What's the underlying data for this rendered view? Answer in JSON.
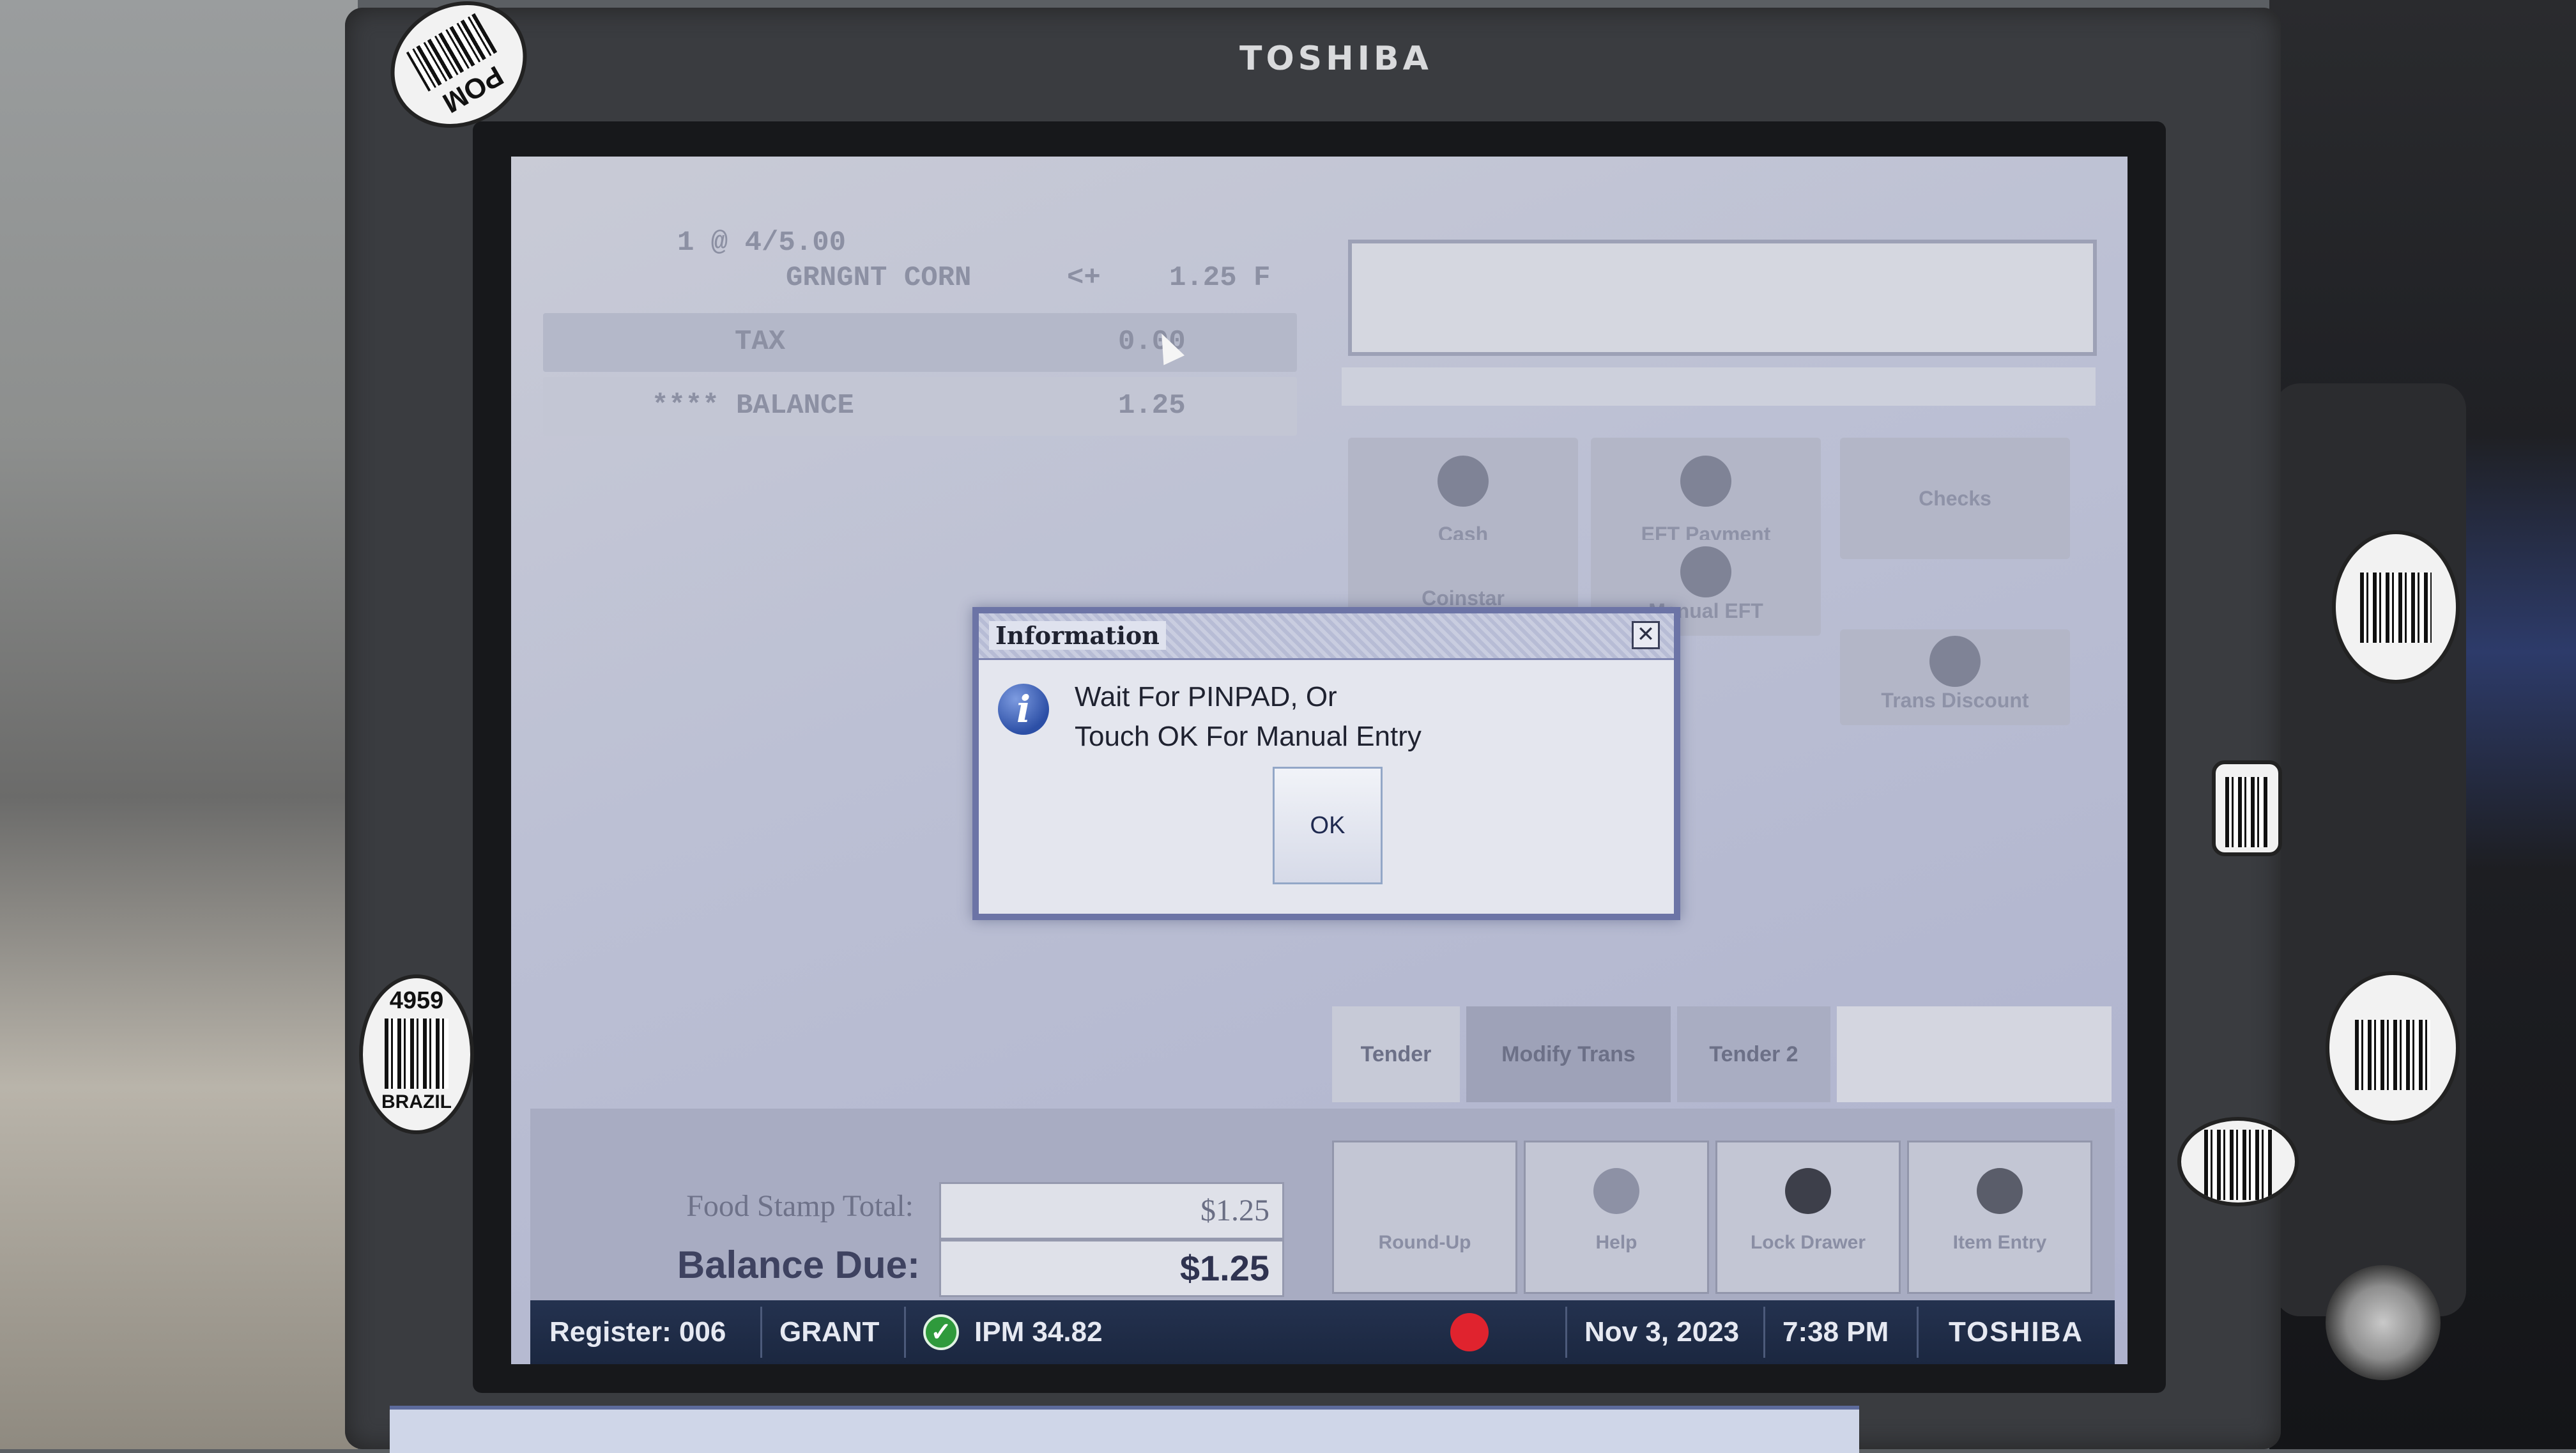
{
  "monitor": {
    "brand_top": "TOSHIBA"
  },
  "receipt": {
    "qty_line": "1 @ 4/5.00",
    "item_name": "GRNGNT CORN",
    "item_mark": "<+",
    "item_price": "1.25 F",
    "tax_label": "TAX",
    "tax_value": "0.00",
    "balance_label": "**** BALANCE",
    "balance_value": "1.25"
  },
  "tender_buttons": {
    "cash": "Cash",
    "eft": "EFT Payment",
    "checks": "Checks",
    "coinstar": "Coinstar",
    "manual_eft": "Manual EFT",
    "trans_discount": "Trans Discount"
  },
  "tabs": [
    "Tender",
    "Modify Trans",
    "Tender 2"
  ],
  "totals": {
    "food_stamp_label": "Food Stamp Total:",
    "food_stamp_value": "$1.25",
    "balance_due_label": "Balance Due:",
    "balance_due_value": "$1.25"
  },
  "function_buttons": [
    "Round-Up",
    "Help",
    "Lock Drawer",
    "Item Entry"
  ],
  "status_bar": {
    "register": "Register: 006",
    "cashier": "GRANT",
    "ipm": "IPM 34.82",
    "date": "Nov 3, 2023",
    "time": "7:38 PM",
    "brand": "TOSHIBA"
  },
  "dialog": {
    "title": "Information",
    "line1": "Wait For PINPAD, Or",
    "line2": "Touch OK For Manual Entry",
    "ok_label": "OK"
  },
  "stickers": {
    "pom": "POM",
    "plu": "4959",
    "origin": "BRAZIL"
  },
  "colors": {
    "screen_bg": "#bcc0d4",
    "dialog_border": "#6c74a6",
    "status_bar": "#1b2740",
    "status_ok": "#2f9a3c",
    "status_alert": "#e0232e"
  }
}
